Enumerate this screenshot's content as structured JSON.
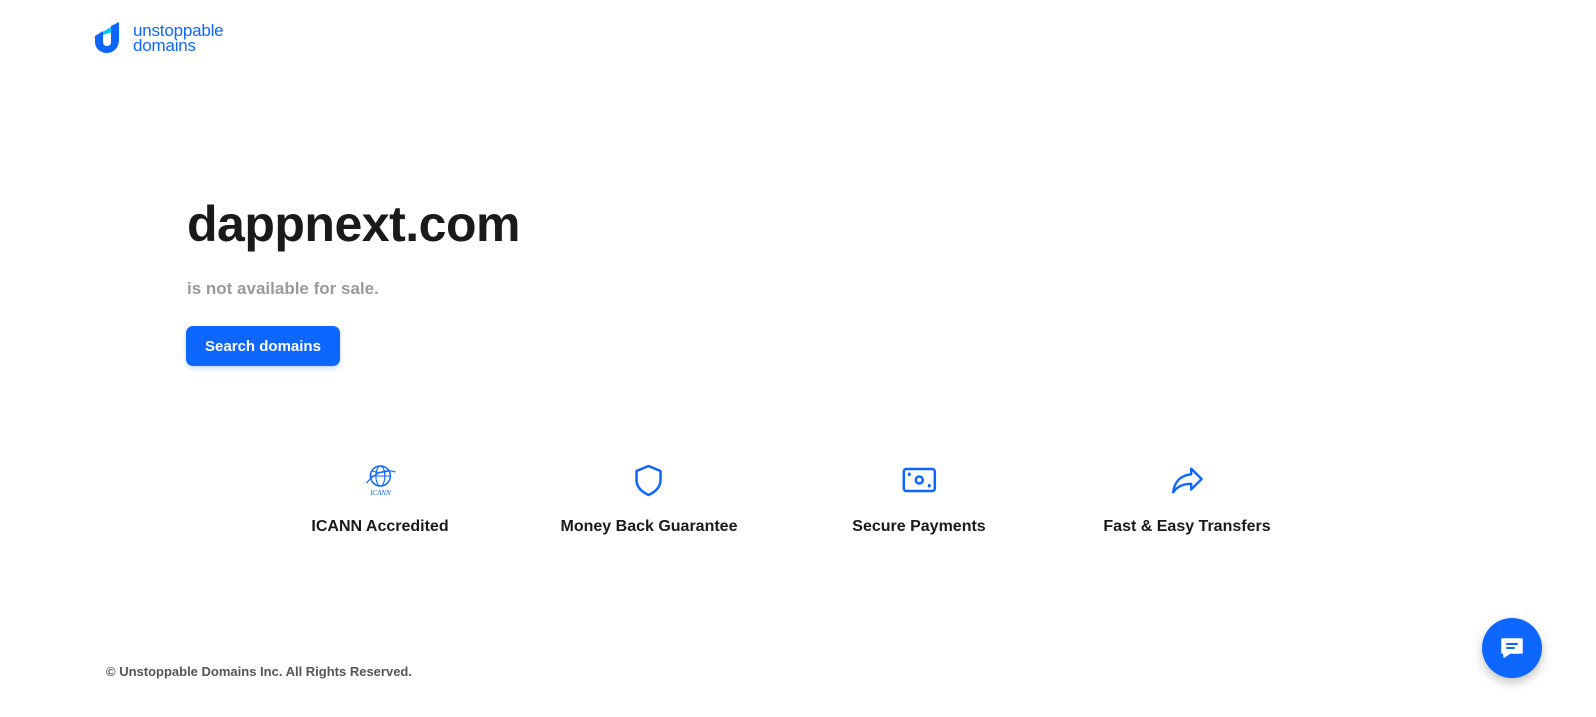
{
  "brand": {
    "line1": "unstoppable",
    "line2": "domains",
    "accent_color": "#0d67fe"
  },
  "hero": {
    "domain": "dappnext.com",
    "status": "is not available for sale.",
    "search_button_label": "Search domains"
  },
  "features": [
    {
      "label": "ICANN Accredited",
      "icon": "icann-globe-icon"
    },
    {
      "label": "Money Back Guarantee",
      "icon": "shield-icon"
    },
    {
      "label": "Secure Payments",
      "icon": "banknote-icon"
    },
    {
      "label": "Fast & Easy Transfers",
      "icon": "share-arrow-icon"
    }
  ],
  "icann_icon_text": "ICANN",
  "footer": {
    "copyright": "© Unstoppable Domains Inc. All Rights Reserved."
  },
  "chat": {
    "icon": "chat-icon"
  }
}
